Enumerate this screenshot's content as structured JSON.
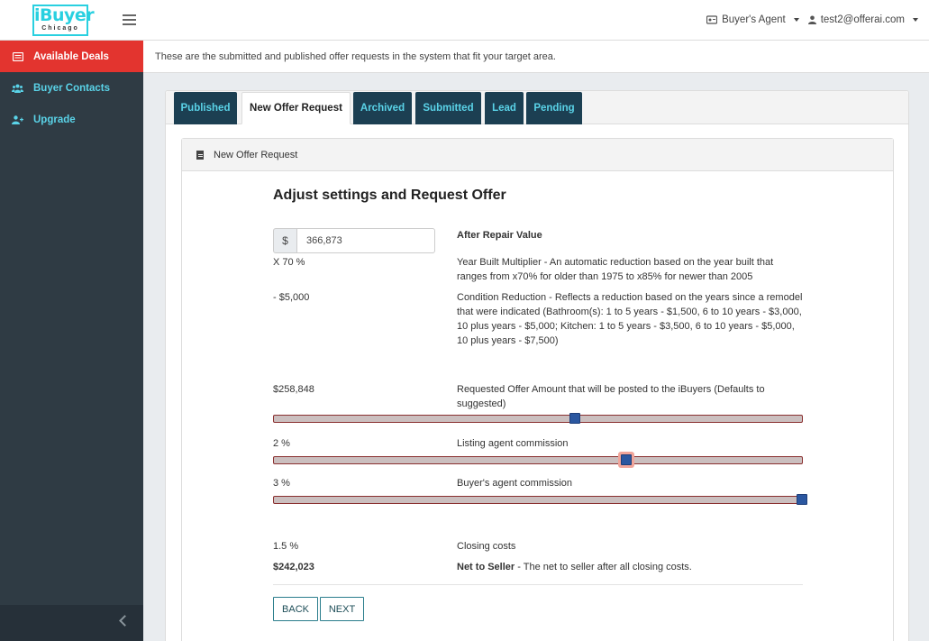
{
  "header": {
    "logo_main": "iBuyer",
    "logo_sub": "Chicago",
    "role_menu": "Buyer's Agent",
    "user_email": "test2@offerai.com"
  },
  "sidebar": {
    "items": [
      {
        "label": "Available Deals",
        "icon": "list-icon",
        "active": true
      },
      {
        "label": "Buyer Contacts",
        "icon": "users-icon",
        "active": false
      },
      {
        "label": "Upgrade",
        "icon": "user-plus-icon",
        "active": false
      }
    ]
  },
  "info_text": "These are the submitted and published offer requests in the system that fit your target area.",
  "tabs": [
    {
      "label": "Published",
      "active": false
    },
    {
      "label": "New Offer Request",
      "active": true
    },
    {
      "label": "Archived",
      "active": false
    },
    {
      "label": "Submitted",
      "active": false
    },
    {
      "label": "Lead",
      "active": false
    },
    {
      "label": "Pending",
      "active": false
    }
  ],
  "card": {
    "header_title": "New Offer Request",
    "heading": "Adjust settings and Request Offer",
    "currency_symbol": "$",
    "arv_value": "366,873",
    "arv_label": "After Repair Value",
    "multiplier_value": "X 70 %",
    "multiplier_desc": "Year Built Multiplier - An automatic reduction based on the year built that ranges from x70% for older than 1975 to x85% for newer than 2005",
    "condition_value": "- $5,000",
    "condition_desc": "Condition Reduction - Reflects a reduction based on the years since a remodel that were indicated (Bathroom(s): 1 to 5 years - $1,500, 6 to 10 years - $3,000, 10 plus years - $5,000; Kitchen: 1 to 5 years - $3,500, 6 to 10 years - $5,000, 10 plus years - $7,500)",
    "offer_value": "$258,848",
    "offer_desc": "Requested Offer Amount that will be posted to the iBuyers (Defaults to suggested)",
    "listing_value": "2 %",
    "listing_desc": "Listing agent commission",
    "buyer_value": "3 %",
    "buyer_desc": "Buyer's agent commission",
    "closing_value": "1.5 %",
    "closing_desc": "Closing costs",
    "net_value": "$242,023",
    "net_label": "Net to Seller",
    "net_desc": " - The net to seller after all closing costs.",
    "back_label": "BACK",
    "next_label": "NEXT"
  },
  "sliders": {
    "offer_fraction": 0.57,
    "listing_fraction": 0.667,
    "buyer_fraction": 1.0
  },
  "colors": {
    "accent": "#5ad3e8",
    "sidebar_bg": "#2f3b44",
    "active_red": "#e3342f",
    "tab_dark": "#1c3f52",
    "slider_thumb": "#2b57a0"
  }
}
